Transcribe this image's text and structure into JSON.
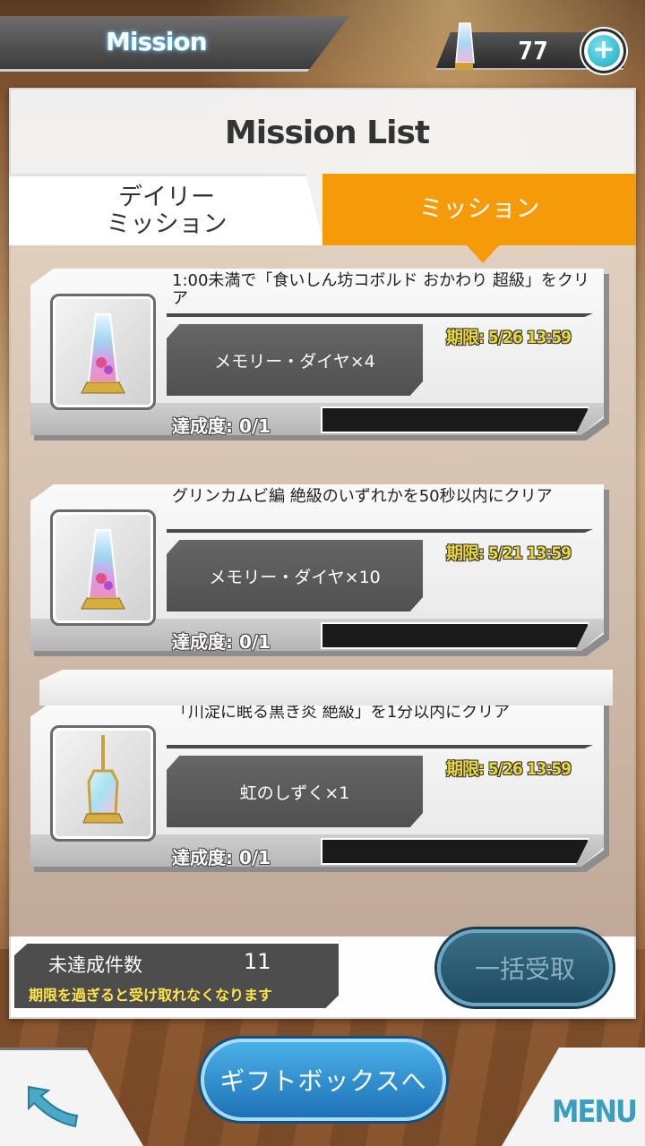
{
  "header": {
    "title": "Mission",
    "currency_value": "77",
    "currency_icon": "memory-diamond-icon",
    "add_icon": "plus-icon"
  },
  "panel": {
    "title": "Mission List",
    "tabs": [
      {
        "label": "デイリー\nミッション",
        "active": false
      },
      {
        "label": "ミッション",
        "active": true
      }
    ]
  },
  "missions": [
    {
      "title": "1:00未満で「食いしん坊コボルド おかわり 超級」をクリア",
      "reward": "メモリー・ダイヤ×4",
      "deadline": "期限: 5/26 13:59",
      "progress": "達成度: 0/1",
      "progress_fraction": 0,
      "icon": "memory-diamond-icon"
    },
    {
      "title": "グリンカムビ編 絶級のいずれかを50秒以内にクリア",
      "reward": "メモリー・ダイヤ×10",
      "deadline": "期限: 5/21 13:59",
      "progress": "達成度: 0/1",
      "progress_fraction": 0,
      "icon": "memory-diamond-icon"
    },
    {
      "title": "「川淀に眠る黒き炎 絶級」を1分以内にクリア",
      "reward": "虹のしずく×1",
      "deadline": "期限: 5/26 13:59",
      "progress": "達成度: 0/1",
      "progress_fraction": 0,
      "icon": "rainbow-drop-bottle-icon"
    }
  ],
  "summary": {
    "label": "未達成件数",
    "count": "11",
    "note": "期限を過ぎると受け取れなくなります",
    "bulk_button": "一括受取"
  },
  "footer": {
    "gift_button": "ギフトボックスへ",
    "back_icon": "back-arrow-icon",
    "menu_label": "MENU"
  },
  "colors": {
    "accent_tab": "#f59b0a",
    "deadline_text": "#e9d63a",
    "gift_button": "#2a8fd0"
  }
}
